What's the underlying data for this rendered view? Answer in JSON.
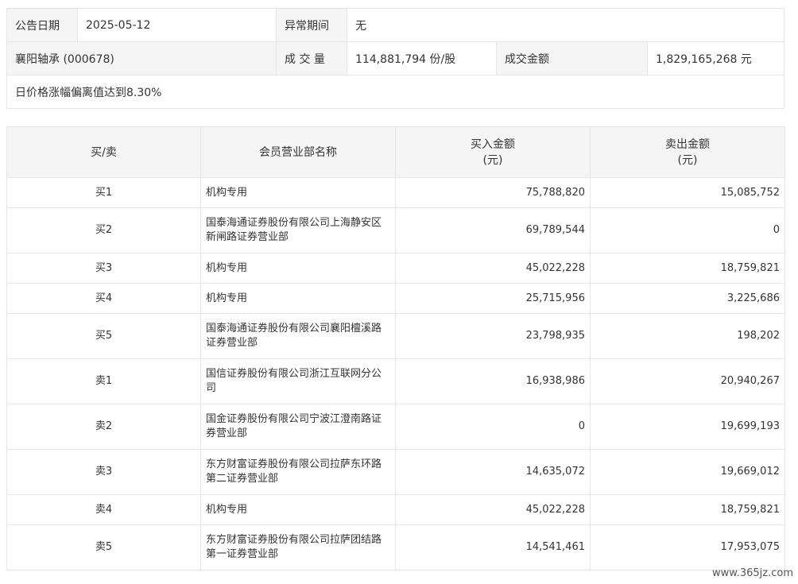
{
  "info": {
    "date_label": "公告日期",
    "date_value": "2025-05-12",
    "abnormal_label": "异常期间",
    "abnormal_value": "无",
    "stock": "襄阳轴承 (000678)",
    "volume_label": "成 交 量",
    "volume_value": "114,881,794 份/股",
    "amount_label": "成交金额",
    "amount_value": "1,829,165,268 元",
    "reason": "日价格涨幅偏离值达到8.30%"
  },
  "table": {
    "headers": {
      "side": "买/卖",
      "name": "会员营业部名称",
      "buy": "买入金额",
      "buy_unit": "(元)",
      "sell": "卖出金额",
      "sell_unit": "(元)"
    },
    "rows": [
      {
        "side": "买1",
        "name": "机构专用",
        "buy": "75,788,820",
        "sell": "15,085,752"
      },
      {
        "side": "买2",
        "name": "国泰海通证券股份有限公司上海静安区新闸路证券营业部",
        "buy": "69,789,544",
        "sell": "0"
      },
      {
        "side": "买3",
        "name": "机构专用",
        "buy": "45,022,228",
        "sell": "18,759,821"
      },
      {
        "side": "买4",
        "name": "机构专用",
        "buy": "25,715,956",
        "sell": "3,225,686"
      },
      {
        "side": "买5",
        "name": "国泰海通证券股份有限公司襄阳檀溪路证券营业部",
        "buy": "23,798,935",
        "sell": "198,202"
      },
      {
        "side": "卖1",
        "name": "国信证券股份有限公司浙江互联网分公司",
        "buy": "16,938,986",
        "sell": "20,940,267"
      },
      {
        "side": "卖2",
        "name": "国金证券股份有限公司宁波江澄南路证券营业部",
        "buy": "0",
        "sell": "19,699,193"
      },
      {
        "side": "卖3",
        "name": "东方财富证券股份有限公司拉萨东环路第二证券营业部",
        "buy": "14,635,072",
        "sell": "19,669,012"
      },
      {
        "side": "卖4",
        "name": "机构专用",
        "buy": "45,022,228",
        "sell": "18,759,821"
      },
      {
        "side": "卖5",
        "name": "东方财富证券股份有限公司拉萨团结路第一证券营业部",
        "buy": "14,541,461",
        "sell": "17,953,075"
      }
    ]
  },
  "watermark": "www.365jz.com"
}
